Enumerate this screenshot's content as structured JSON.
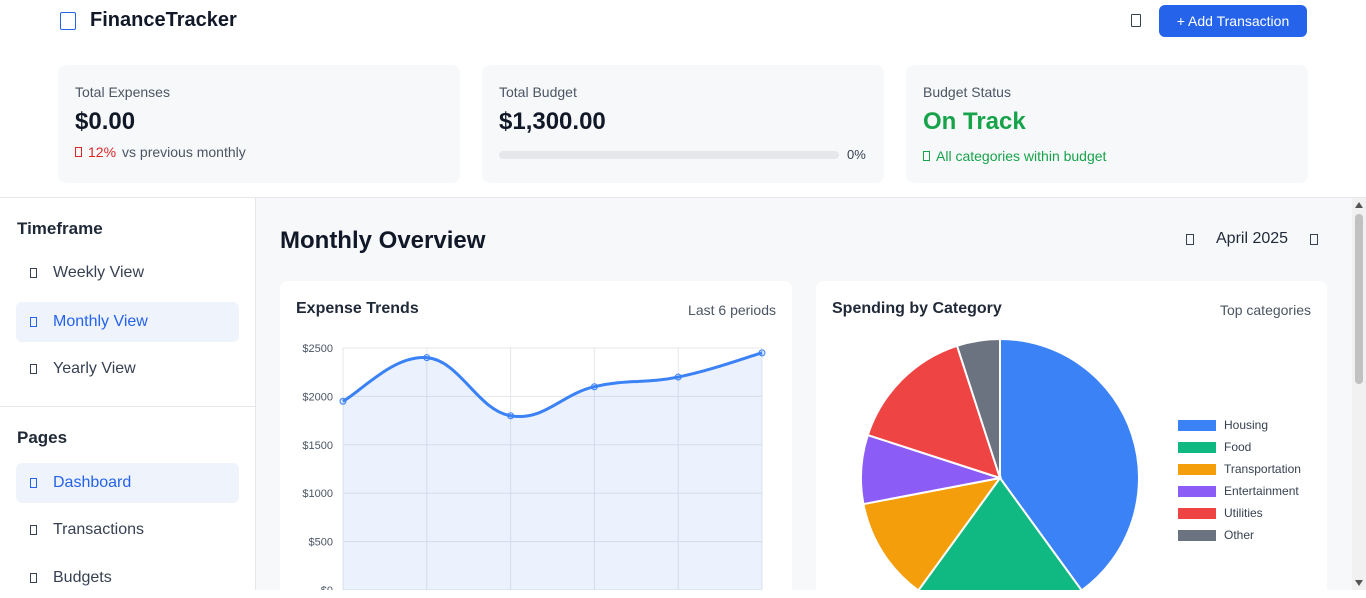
{
  "app": {
    "title": "FinanceTracker",
    "add_button": "+ Add Transaction"
  },
  "summary": {
    "expenses": {
      "label": "Total Expenses",
      "value": "$0.00",
      "change": "12%",
      "change_suffix": "vs previous monthly"
    },
    "budget": {
      "label": "Total Budget",
      "value": "$1,300.00",
      "progress_text": "0%",
      "progress": 0
    },
    "status": {
      "label": "Budget Status",
      "value": "On Track",
      "note": "All categories within budget"
    }
  },
  "sidebar": {
    "timeframe_heading": "Timeframe",
    "timeframe": [
      "Weekly View",
      "Monthly View",
      "Yearly View"
    ],
    "pages_heading": "Pages",
    "pages": [
      "Dashboard",
      "Transactions",
      "Budgets"
    ]
  },
  "main": {
    "title": "Monthly Overview",
    "period": "April 2025"
  },
  "trend_panel": {
    "title": "Expense Trends",
    "meta": "Last 6 periods"
  },
  "category_panel": {
    "title": "Spending by Category",
    "meta": "Top categories"
  },
  "colors": {
    "accent": "#2563eb",
    "good": "#16a34a",
    "bad": "#dc2626"
  },
  "chart_data": [
    {
      "type": "line",
      "x": [
        "",
        "",
        "",
        "",
        "",
        ""
      ],
      "values": [
        1950,
        2400,
        1800,
        2100,
        2200,
        2450
      ],
      "yticks": [
        "$2500",
        "$2000",
        "$1500",
        "$1000",
        "$500",
        "$0"
      ],
      "ylim": [
        0,
        2500
      ],
      "grid": true,
      "color": "#3b82f6"
    },
    {
      "type": "pie",
      "labels": [
        "Housing",
        "Food",
        "Transportation",
        "Entertainment",
        "Utilities",
        "Other"
      ],
      "values": [
        40,
        20,
        12,
        8,
        15,
        5
      ],
      "colors": [
        "#3b82f6",
        "#10b981",
        "#f59e0b",
        "#8b5cf6",
        "#ef4444",
        "#6b7280"
      ],
      "legend": "right"
    }
  ]
}
